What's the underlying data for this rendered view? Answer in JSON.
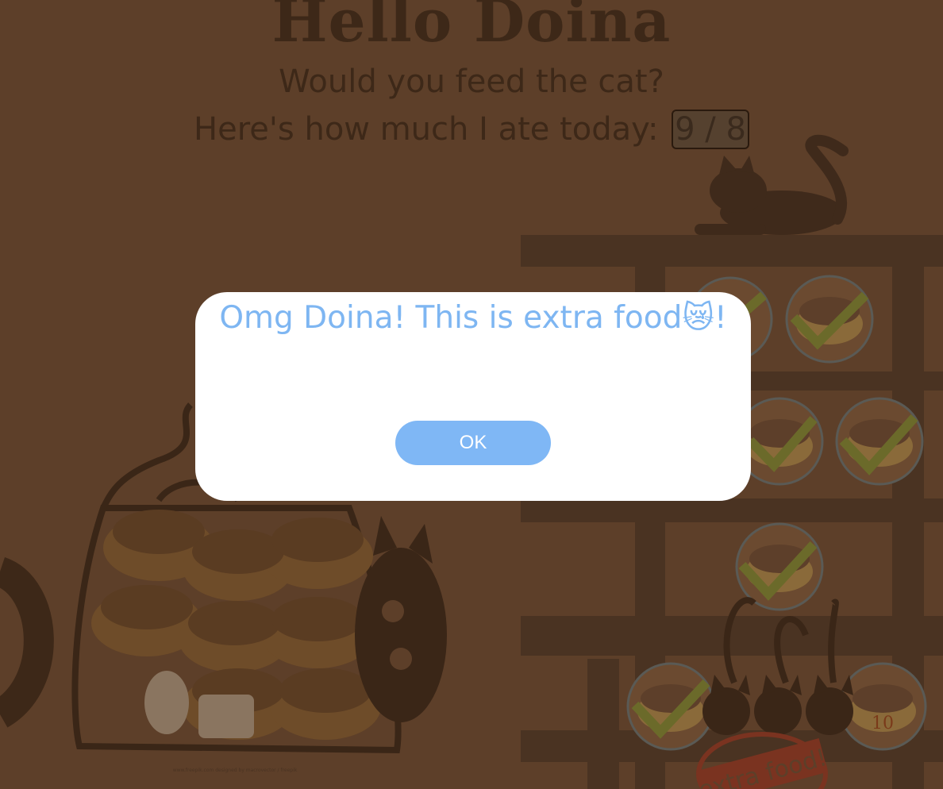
{
  "header": {
    "title": "Hello Doina",
    "subtitle": "Would you feed the cat?",
    "ate_label": "Here's how much I ate today:",
    "ate_count": "9 / 8"
  },
  "bowls": {
    "counter_label": "10"
  },
  "banner": {
    "text": "extra food!"
  },
  "footer": {
    "credit": "www.freepik.com designed by macrovector / freepik"
  },
  "modal": {
    "title": "Omg Doina! This is extra food😿!",
    "ok_label": "OK"
  },
  "colors": {
    "background": "#5d3f29",
    "modal_text": "#7eb6f2",
    "ok_button": "#7fb7f5"
  },
  "icons": [
    "cat-icon",
    "food-bowl-icon",
    "check-icon",
    "food-bag-icon",
    "scared-cat-emoji"
  ]
}
